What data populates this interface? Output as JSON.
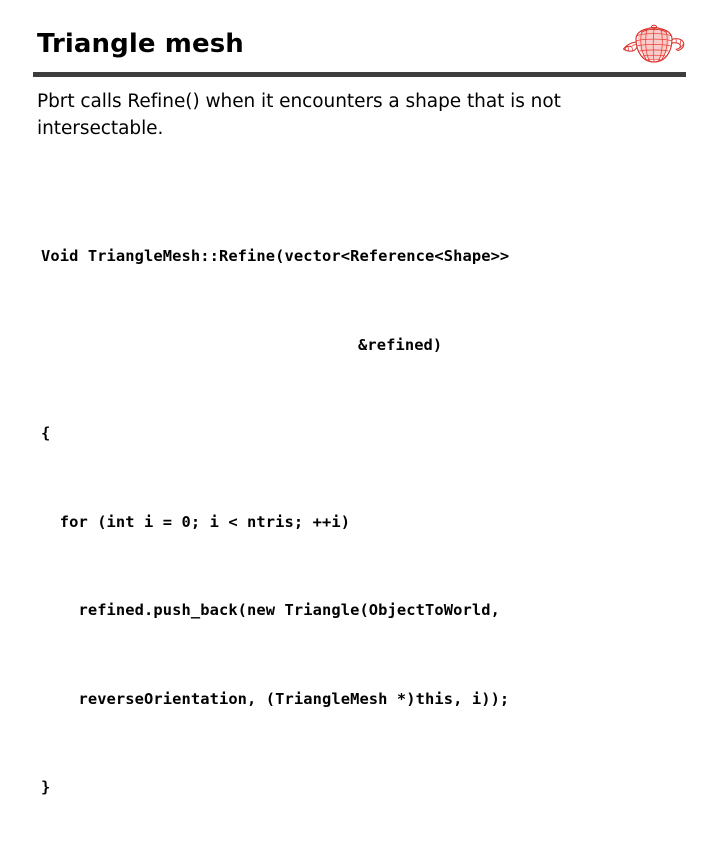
{
  "slide": {
    "title": "Triangle mesh",
    "logo": {
      "icon_name": "utah-teapot-wireframe-logo",
      "color": "#e8342e"
    },
    "rule_color": "#3d3d3d",
    "background_color": "#ffffff",
    "text_color": "#000000"
  },
  "body": {
    "paragraph_part1": "Pbrt calls ",
    "paragraph_code": "Refine()",
    "paragraph_part2": " when it encounters a shape that is not intersectable.",
    "paragraph_full": "Pbrt calls Refine() when it encounters a shape that is not intersectable."
  },
  "code": {
    "language": "cpp",
    "lines": [
      "Void TriangleMesh::Refine(vector<Reference<Shape>>",
      "&refined)",
      "{",
      "  for (int i = 0; i < ntris; ++i)",
      "    refined.push_back(new Triangle(ObjectToWorld,",
      "    reverseOrientation, (TriangleMesh *)this, i));",
      "}"
    ]
  }
}
